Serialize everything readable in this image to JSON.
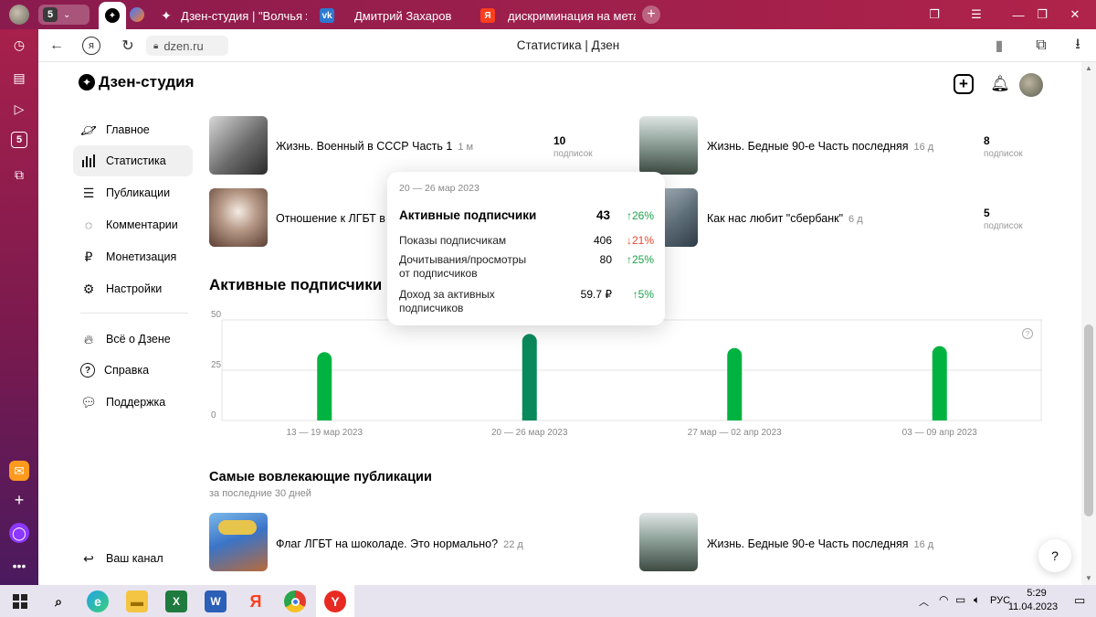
{
  "browser": {
    "tabs": [
      {
        "label": "Дзен-студия | \"Волчья жи",
        "favicon": "dzen-icon"
      },
      {
        "label": "Дмитрий Захаров",
        "favicon": "vk-icon"
      },
      {
        "label": "дискриминация на метал",
        "favicon": "yandex-icon"
      }
    ],
    "tab_badge": "5",
    "domain": "dzen.ru",
    "page_title": "Статистика | Дзен"
  },
  "app": {
    "logo": "Дзен-студия",
    "nav": [
      {
        "label": "Главное",
        "icon": "planet-icon"
      },
      {
        "label": "Статистика",
        "icon": "bar-chart-icon"
      },
      {
        "label": "Публикации",
        "icon": "stack-icon"
      },
      {
        "label": "Комментарии",
        "icon": "comment-icon"
      },
      {
        "label": "Монетизация",
        "icon": "ruble-icon"
      },
      {
        "label": "Настройки",
        "icon": "gear-icon"
      }
    ],
    "nav2": [
      {
        "label": "Всё о Дзене",
        "icon": "flame-icon"
      },
      {
        "label": "Справка",
        "icon": "help-icon"
      },
      {
        "label": "Поддержка",
        "icon": "support-icon"
      }
    ],
    "your_channel": "Ваш канал"
  },
  "top_posts": [
    {
      "title": "Жизнь. Военный в СССР Часть 1",
      "age": "1 м",
      "stat": "10",
      "stat_label": "подписок"
    },
    {
      "title": "Жизнь. Бедные 90-е Часть последняя",
      "age": "16 д",
      "stat": "8",
      "stat_label": "подписок"
    },
    {
      "title": "Отношение к ЛГБТ в м",
      "age": "",
      "stat": "",
      "stat_label": ""
    },
    {
      "title": "Как нас любит \"сбербанк\"",
      "age": "6 д",
      "stat": "5",
      "stat_label": "подписок"
    }
  ],
  "tooltip": {
    "period": "20 — 26 мар 2023",
    "main_label": "Активные подписчики",
    "main_value": "43",
    "main_change": "↑26%",
    "rows": [
      {
        "label": "Показы подписчикам",
        "value": "406",
        "change": "↓21%",
        "dir": "down"
      },
      {
        "label": "Дочитывания/просмотры от подписчиков",
        "value": "80",
        "change": "↑25%",
        "dir": "up"
      },
      {
        "label": "Доход за активных подписчиков",
        "value": "59.7 ₽",
        "change": "↑5%",
        "dir": "up"
      }
    ]
  },
  "section_title": "Активные подписчики",
  "chart_data": {
    "type": "bar",
    "categories": [
      "13 — 19 мар 2023",
      "20 — 26 мар 2023",
      "27 мар — 02 апр 2023",
      "03 — 09 апр 2023"
    ],
    "values": [
      34,
      43,
      36,
      37
    ],
    "y_ticks": [
      "50",
      "25",
      "0"
    ],
    "ylim": [
      0,
      50
    ],
    "grid": true,
    "colors": {
      "default": "#00b341",
      "highlight": "#0a8a5a"
    },
    "highlight_index": 1
  },
  "engaging": {
    "title": "Самые вовлекающие публикации",
    "subtitle": "за последние 30 дней",
    "posts": [
      {
        "title": "Флаг ЛГБТ на шоколаде. Это нормально?",
        "age": "22 д"
      },
      {
        "title": "Жизнь. Бедные 90-е Часть последняя",
        "age": "16 д"
      }
    ]
  },
  "help_button": "?",
  "taskbar": {
    "lang": "РУС",
    "time": "5:29",
    "date": "11.04.2023"
  }
}
